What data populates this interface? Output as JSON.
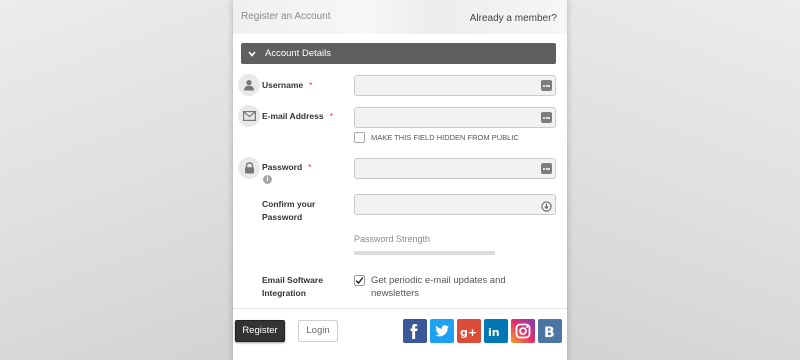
{
  "header": {
    "title": "Register an Account",
    "member_link": "Already a member?"
  },
  "section": {
    "title": "Account Details"
  },
  "fields": {
    "username": {
      "label": "Username",
      "required": "*",
      "value": ""
    },
    "email": {
      "label": "E-mail Address",
      "required": "*",
      "value": "",
      "hide_label": "MAKE THIS FIELD HIDDEN FROM PUBLIC",
      "hide_checked": false
    },
    "password": {
      "label": "Password",
      "required": "*",
      "value": ""
    },
    "confirm": {
      "label_line1": "Confirm your",
      "label_line2": "Password",
      "value": ""
    },
    "strength": {
      "label": "Password Strength",
      "level": 0
    },
    "newsletter": {
      "label_line1": "Email Software",
      "label_line2": "Integration",
      "option": "Get periodic e-mail updates and newsletters",
      "checked": true
    }
  },
  "footer": {
    "register_label": "Register",
    "login_label": "Login",
    "social": [
      {
        "name": "facebook-icon",
        "glyph": "f",
        "color": "#3b5998"
      },
      {
        "name": "twitter-icon",
        "glyph": "t",
        "color": "#1da1f2"
      },
      {
        "name": "google-plus-icon",
        "glyph": "g+",
        "color": "#dd4b39"
      },
      {
        "name": "linkedin-icon",
        "glyph": "in",
        "color": "#0077b5"
      },
      {
        "name": "instagram-icon",
        "glyph": "ig",
        "color": "#c13584"
      },
      {
        "name": "vk-icon",
        "glyph": "B",
        "color": "#4c75a3"
      }
    ]
  }
}
